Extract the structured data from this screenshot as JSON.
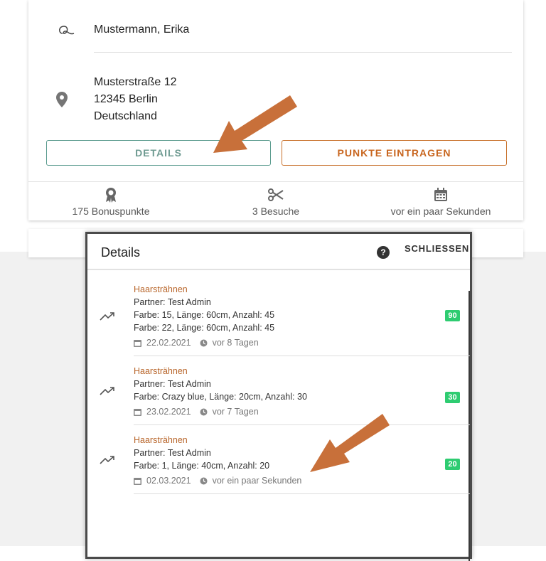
{
  "customer": {
    "name": "Mustermann, Erika",
    "address": [
      "Musterstraße 12",
      "12345 Berlin",
      "Deutschland"
    ]
  },
  "buttons": {
    "details": "DETAILS",
    "points": "PUNKTE EINTRAGEN"
  },
  "stats": [
    {
      "icon": "award-icon",
      "label": "175 Bonuspunkte"
    },
    {
      "icon": "scissors-icon",
      "label": "3 Besuche"
    },
    {
      "icon": "calendar-icon",
      "label": "vor ein paar Sekunden"
    }
  ],
  "dialog": {
    "title": "Details",
    "close_label": "SCHLIESSEN",
    "help_symbol": "?",
    "entries": [
      {
        "title": "Haarsträhnen",
        "partner": "Partner: Test Admin",
        "lines": [
          "Farbe: 15, Länge: 60cm, Anzahl: 45",
          "Farbe: 22, Länge: 60cm, Anzahl: 45"
        ],
        "date": "22.02.2021",
        "ago": "vor 8 Tagen",
        "points": "90"
      },
      {
        "title": "Haarsträhnen",
        "partner": "Partner: Test Admin",
        "lines": [
          "Farbe: Crazy blue, Länge: 20cm, Anzahl: 30"
        ],
        "date": "23.02.2021",
        "ago": "vor 7 Tagen",
        "points": "30"
      },
      {
        "title": "Haarsträhnen",
        "partner": "Partner: Test Admin",
        "lines": [
          "Farbe: 1, Länge: 40cm, Anzahl: 20"
        ],
        "date": "02.03.2021",
        "ago": "vor ein paar Sekunden",
        "points": "20"
      }
    ]
  },
  "colors": {
    "accent_orange": "#c8651e",
    "accent_teal": "#5a9b8e",
    "badge_green": "#2ecc71",
    "annotation_arrow": "#c8703a"
  }
}
